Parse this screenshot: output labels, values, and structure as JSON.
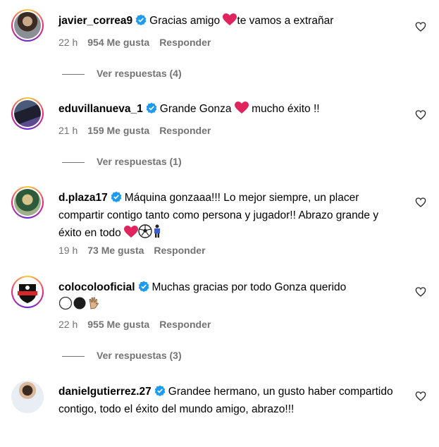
{
  "colors": {
    "verified": "#1d9bf0",
    "heart": "#e0245e",
    "meta": "#737373"
  },
  "comments": [
    {
      "username": "javier_correa9",
      "text": "Gracias amigo",
      "text_after": "te vamos a extrañar",
      "time": "22 h",
      "likes": "954 Me gusta",
      "reply": "Responder",
      "replies": "Ver respuestas (4)",
      "emoji_1": "heart",
      "avatar_icon": "profile-photo"
    },
    {
      "username": "eduvillanueva_1",
      "text": "Grande Gonza",
      "text_after": "mucho éxito !!",
      "time": "21 h",
      "likes": "159 Me gusta",
      "reply": "Responder",
      "replies": "Ver respuestas (1)",
      "emoji_1": "heart"
    },
    {
      "username": "d.plaza17",
      "text": "Máquina gonzaaa!!! Lo mejor siempre, un placer compartir contigo tanto como persona y jugador!! Abrazo grande y éxito en todo",
      "time": "19 h",
      "likes": "73 Me gusta",
      "reply": "Responder",
      "emojis": [
        "heart",
        "soccer-ball",
        "player"
      ]
    },
    {
      "username": "colocolooficial",
      "text": "Muchas gracias por todo Gonza querido",
      "time": "22 h",
      "likes": "955 Me gusta",
      "reply": "Responder",
      "replies": "Ver respuestas (3)",
      "emojis": [
        "white-circle",
        "black-circle",
        "hand"
      ]
    },
    {
      "username": "danielgutierrez.27",
      "text": "Grandee hermano, un gusto haber compartido contigo, todo el éxito del mundo amigo, abrazo!!!"
    }
  ]
}
